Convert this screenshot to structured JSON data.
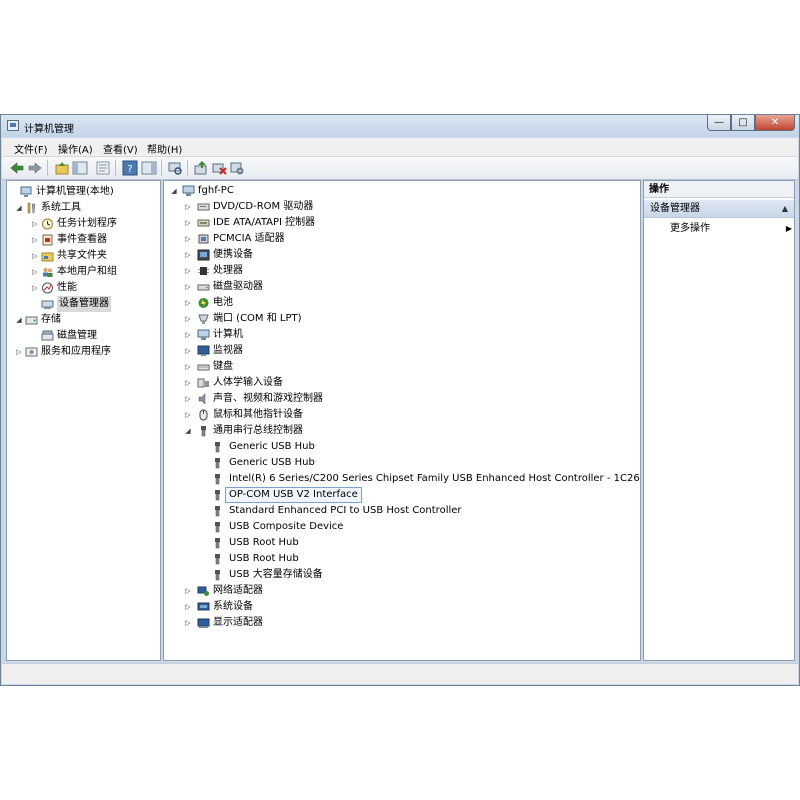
{
  "window": {
    "title": "计算机管理"
  },
  "menu": [
    {
      "id": "file",
      "label": "文件(F)"
    },
    {
      "id": "action",
      "label": "操作(A)"
    },
    {
      "id": "view",
      "label": "查看(V)"
    },
    {
      "id": "help",
      "label": "帮助(H)"
    }
  ],
  "left_tree": [
    {
      "label": "计算机管理(本地)",
      "level": 0,
      "expander": "",
      "icon": "computer-management-icon"
    },
    {
      "label": "系统工具",
      "level": 1,
      "expander": "open",
      "icon": "tools-icon"
    },
    {
      "label": "任务计划程序",
      "level": 2,
      "expander": "closed",
      "icon": "clock-icon"
    },
    {
      "label": "事件查看器",
      "level": 2,
      "expander": "closed",
      "icon": "event-viewer-icon"
    },
    {
      "label": "共享文件夹",
      "level": 2,
      "expander": "closed",
      "icon": "shared-folder-icon"
    },
    {
      "label": "本地用户和组",
      "level": 2,
      "expander": "closed",
      "icon": "users-icon"
    },
    {
      "label": "性能",
      "level": 2,
      "expander": "closed",
      "icon": "performance-icon"
    },
    {
      "label": "设备管理器",
      "level": 2,
      "expander": "",
      "icon": "device-manager-icon",
      "selected": true
    },
    {
      "label": "存储",
      "level": 1,
      "expander": "open",
      "icon": "storage-icon"
    },
    {
      "label": "磁盘管理",
      "level": 2,
      "expander": "",
      "icon": "disk-management-icon"
    },
    {
      "label": "服务和应用程序",
      "level": 1,
      "expander": "closed",
      "icon": "services-icon"
    }
  ],
  "device_tree": {
    "root": "fghf-PC",
    "categories": [
      {
        "label": "DVD/CD-ROM 驱动器",
        "icon": "dvd-drive-icon"
      },
      {
        "label": "IDE ATA/ATAPI 控制器",
        "icon": "ide-controller-icon"
      },
      {
        "label": "PCMCIA 适配器",
        "icon": "pcmcia-icon"
      },
      {
        "label": "便携设备",
        "icon": "portable-device-icon"
      },
      {
        "label": "处理器",
        "icon": "processor-icon"
      },
      {
        "label": "磁盘驱动器",
        "icon": "disk-drive-icon"
      },
      {
        "label": "电池",
        "icon": "battery-icon"
      },
      {
        "label": "端口 (COM 和 LPT)",
        "icon": "port-icon"
      },
      {
        "label": "计算机",
        "icon": "computer-icon"
      },
      {
        "label": "监视器",
        "icon": "monitor-icon"
      },
      {
        "label": "键盘",
        "icon": "keyboard-icon"
      },
      {
        "label": "人体学输入设备",
        "icon": "hid-icon"
      },
      {
        "label": "声音、视频和游戏控制器",
        "icon": "sound-icon"
      },
      {
        "label": "鼠标和其他指针设备",
        "icon": "mouse-icon"
      },
      {
        "label": "通用串行总线控制器",
        "icon": "usb-icon",
        "expanded": true
      }
    ],
    "usb_children": [
      "Generic USB Hub",
      "Generic USB Hub",
      "Intel(R) 6 Series/C200 Series Chipset Family USB Enhanced Host Controller - 1C26",
      "OP-COM USB V2 Interface",
      "Standard Enhanced PCI to USB Host Controller",
      "USB Composite Device",
      "USB Root Hub",
      "USB Root Hub",
      "USB 大容量存储设备"
    ],
    "usb_selected_index": 3,
    "after": [
      {
        "label": "网络适配器",
        "icon": "network-adapter-icon"
      },
      {
        "label": "系统设备",
        "icon": "system-device-icon"
      },
      {
        "label": "显示适配器",
        "icon": "display-adapter-icon"
      }
    ]
  },
  "actions": {
    "header": "操作",
    "group": "设备管理器",
    "more": "更多操作"
  },
  "colors": {
    "accent": "#4d7ab0",
    "selection_border": "#7da2ce"
  }
}
